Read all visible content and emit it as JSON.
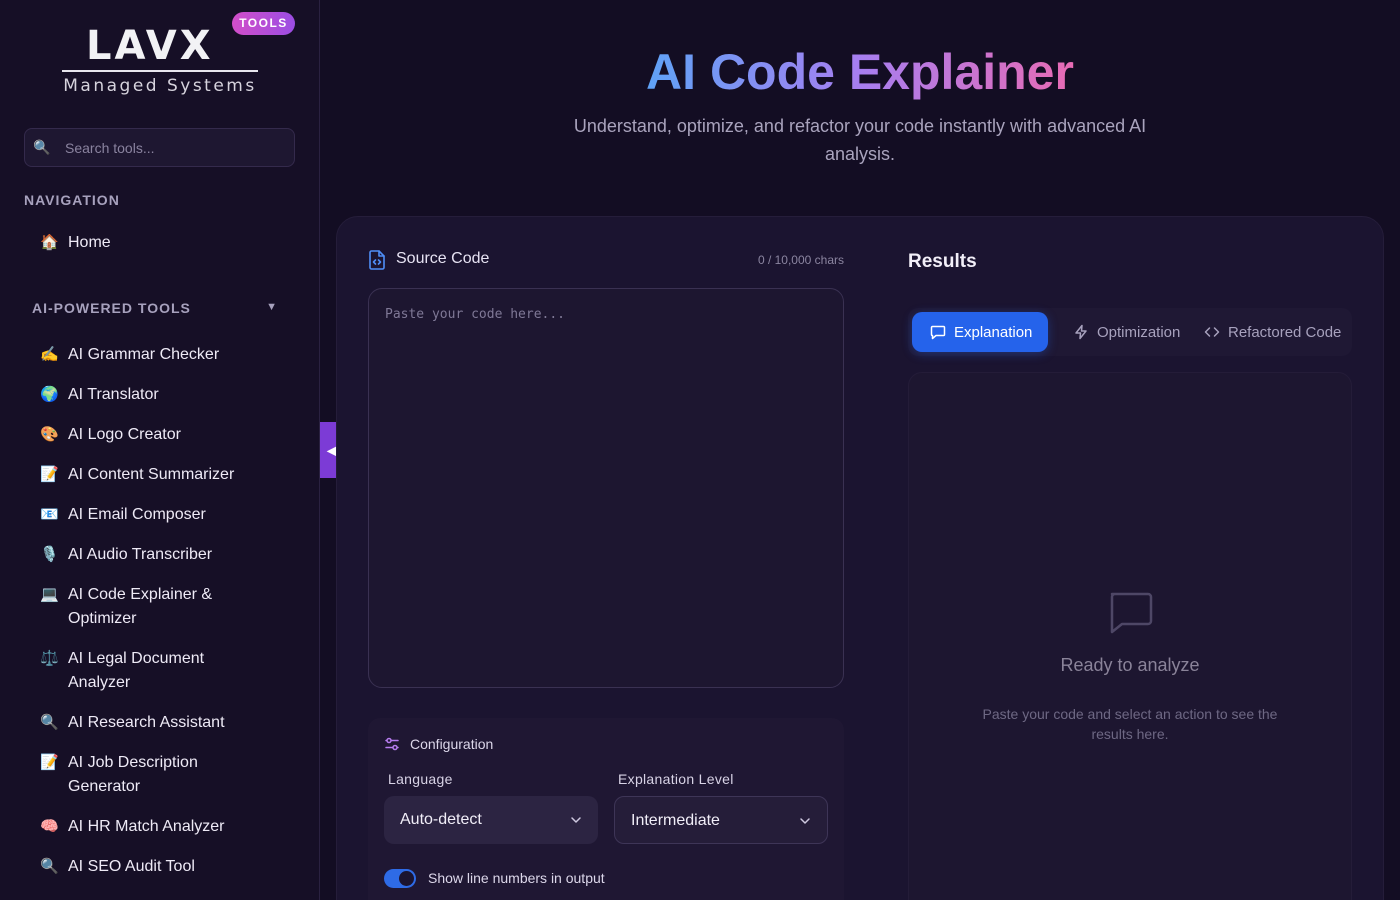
{
  "brand": {
    "logo_text": "LAVX",
    "logo_subtitle": "Managed Systems",
    "badge": "TOOLS"
  },
  "sidebar": {
    "search_placeholder": "Search tools...",
    "navigation_heading": "NAVIGATION",
    "home": {
      "icon": "🏠",
      "label": "Home"
    },
    "section_heading": "AI-POWERED TOOLS",
    "section_caret": "▼",
    "tools": [
      {
        "icon": "✍️",
        "label": "AI Grammar Checker"
      },
      {
        "icon": "🌍",
        "label": "AI Translator"
      },
      {
        "icon": "🎨",
        "label": "AI Logo Creator"
      },
      {
        "icon": "📝",
        "label": "AI Content Summarizer"
      },
      {
        "icon": "📧",
        "label": "AI Email Composer"
      },
      {
        "icon": "🎙️",
        "label": "AI Audio Transcriber"
      },
      {
        "icon": "💻",
        "label": "AI Code Explainer & Optimizer"
      },
      {
        "icon": "⚖️",
        "label": "AI Legal Document Analyzer"
      },
      {
        "icon": "🔍",
        "label": "AI Research Assistant"
      },
      {
        "icon": "📝",
        "label": "AI Job Description Generator"
      },
      {
        "icon": "🧠",
        "label": "AI HR Match Analyzer"
      },
      {
        "icon": "🔍",
        "label": "AI SEO Audit Tool"
      }
    ],
    "collapse_glyph": "◀"
  },
  "header": {
    "title": "AI Code Explainer",
    "subtitle": "Understand, optimize, and refactor your code instantly with advanced AI analysis."
  },
  "source": {
    "title": "Source Code",
    "char_count": "0 / 10,000 chars",
    "placeholder": "Paste your code here..."
  },
  "config": {
    "title": "Configuration",
    "language_label": "Language",
    "language_value": "Auto-detect",
    "level_label": "Explanation Level",
    "level_value": "Intermediate",
    "line_numbers_label": "Show line numbers in output",
    "line_numbers_on": true
  },
  "results": {
    "title": "Results",
    "tabs": [
      {
        "label": "Explanation",
        "icon": "message-square-icon",
        "active": true
      },
      {
        "label": "Optimization",
        "icon": "zap-icon",
        "active": false
      },
      {
        "label": "Refactored Code",
        "icon": "code-icon",
        "active": false
      }
    ],
    "empty_title": "Ready to analyze",
    "empty_desc": "Paste your code and select an action to see the results here."
  },
  "colors": {
    "background": "#130d23",
    "sidebar": "#160f26",
    "accent_blue": "#2563eb",
    "accent_purple": "#7c3bd6",
    "badge_gradient_start": "#d24ec9",
    "title_gradient": [
      "#5fa2f6",
      "#a77ef0",
      "#e86bb4"
    ]
  }
}
